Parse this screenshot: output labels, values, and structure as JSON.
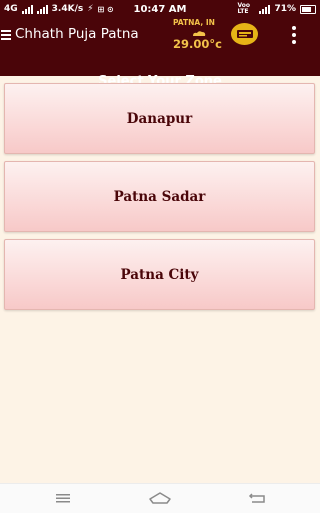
{
  "status_bar": {
    "network": "4G",
    "speed": "3.4K/s",
    "time": "10:47 AM",
    "carrier": "Voo LTE",
    "battery": "71%"
  },
  "app_bar": {
    "title": "Chhath Puja Patna",
    "weather_city": "PATNA, IN",
    "weather_temp": "29.00°c"
  },
  "page": {
    "heading": "Select Your Zone"
  },
  "zones": [
    {
      "label": "Danapur"
    },
    {
      "label": "Patna Sadar"
    },
    {
      "label": "Patna City"
    }
  ],
  "colors": {
    "primary": "#4a0509",
    "accent": "#f3c24a",
    "background": "#fdf3e6",
    "button_bg": "#fad9d8"
  },
  "icons": {
    "menu": "hamburger-menu-icon",
    "weather": "cloud-sun-icon",
    "badge": "app-badge-icon",
    "more": "more-vertical-icon",
    "nav": [
      "recents-icon",
      "home-icon",
      "back-icon"
    ]
  }
}
